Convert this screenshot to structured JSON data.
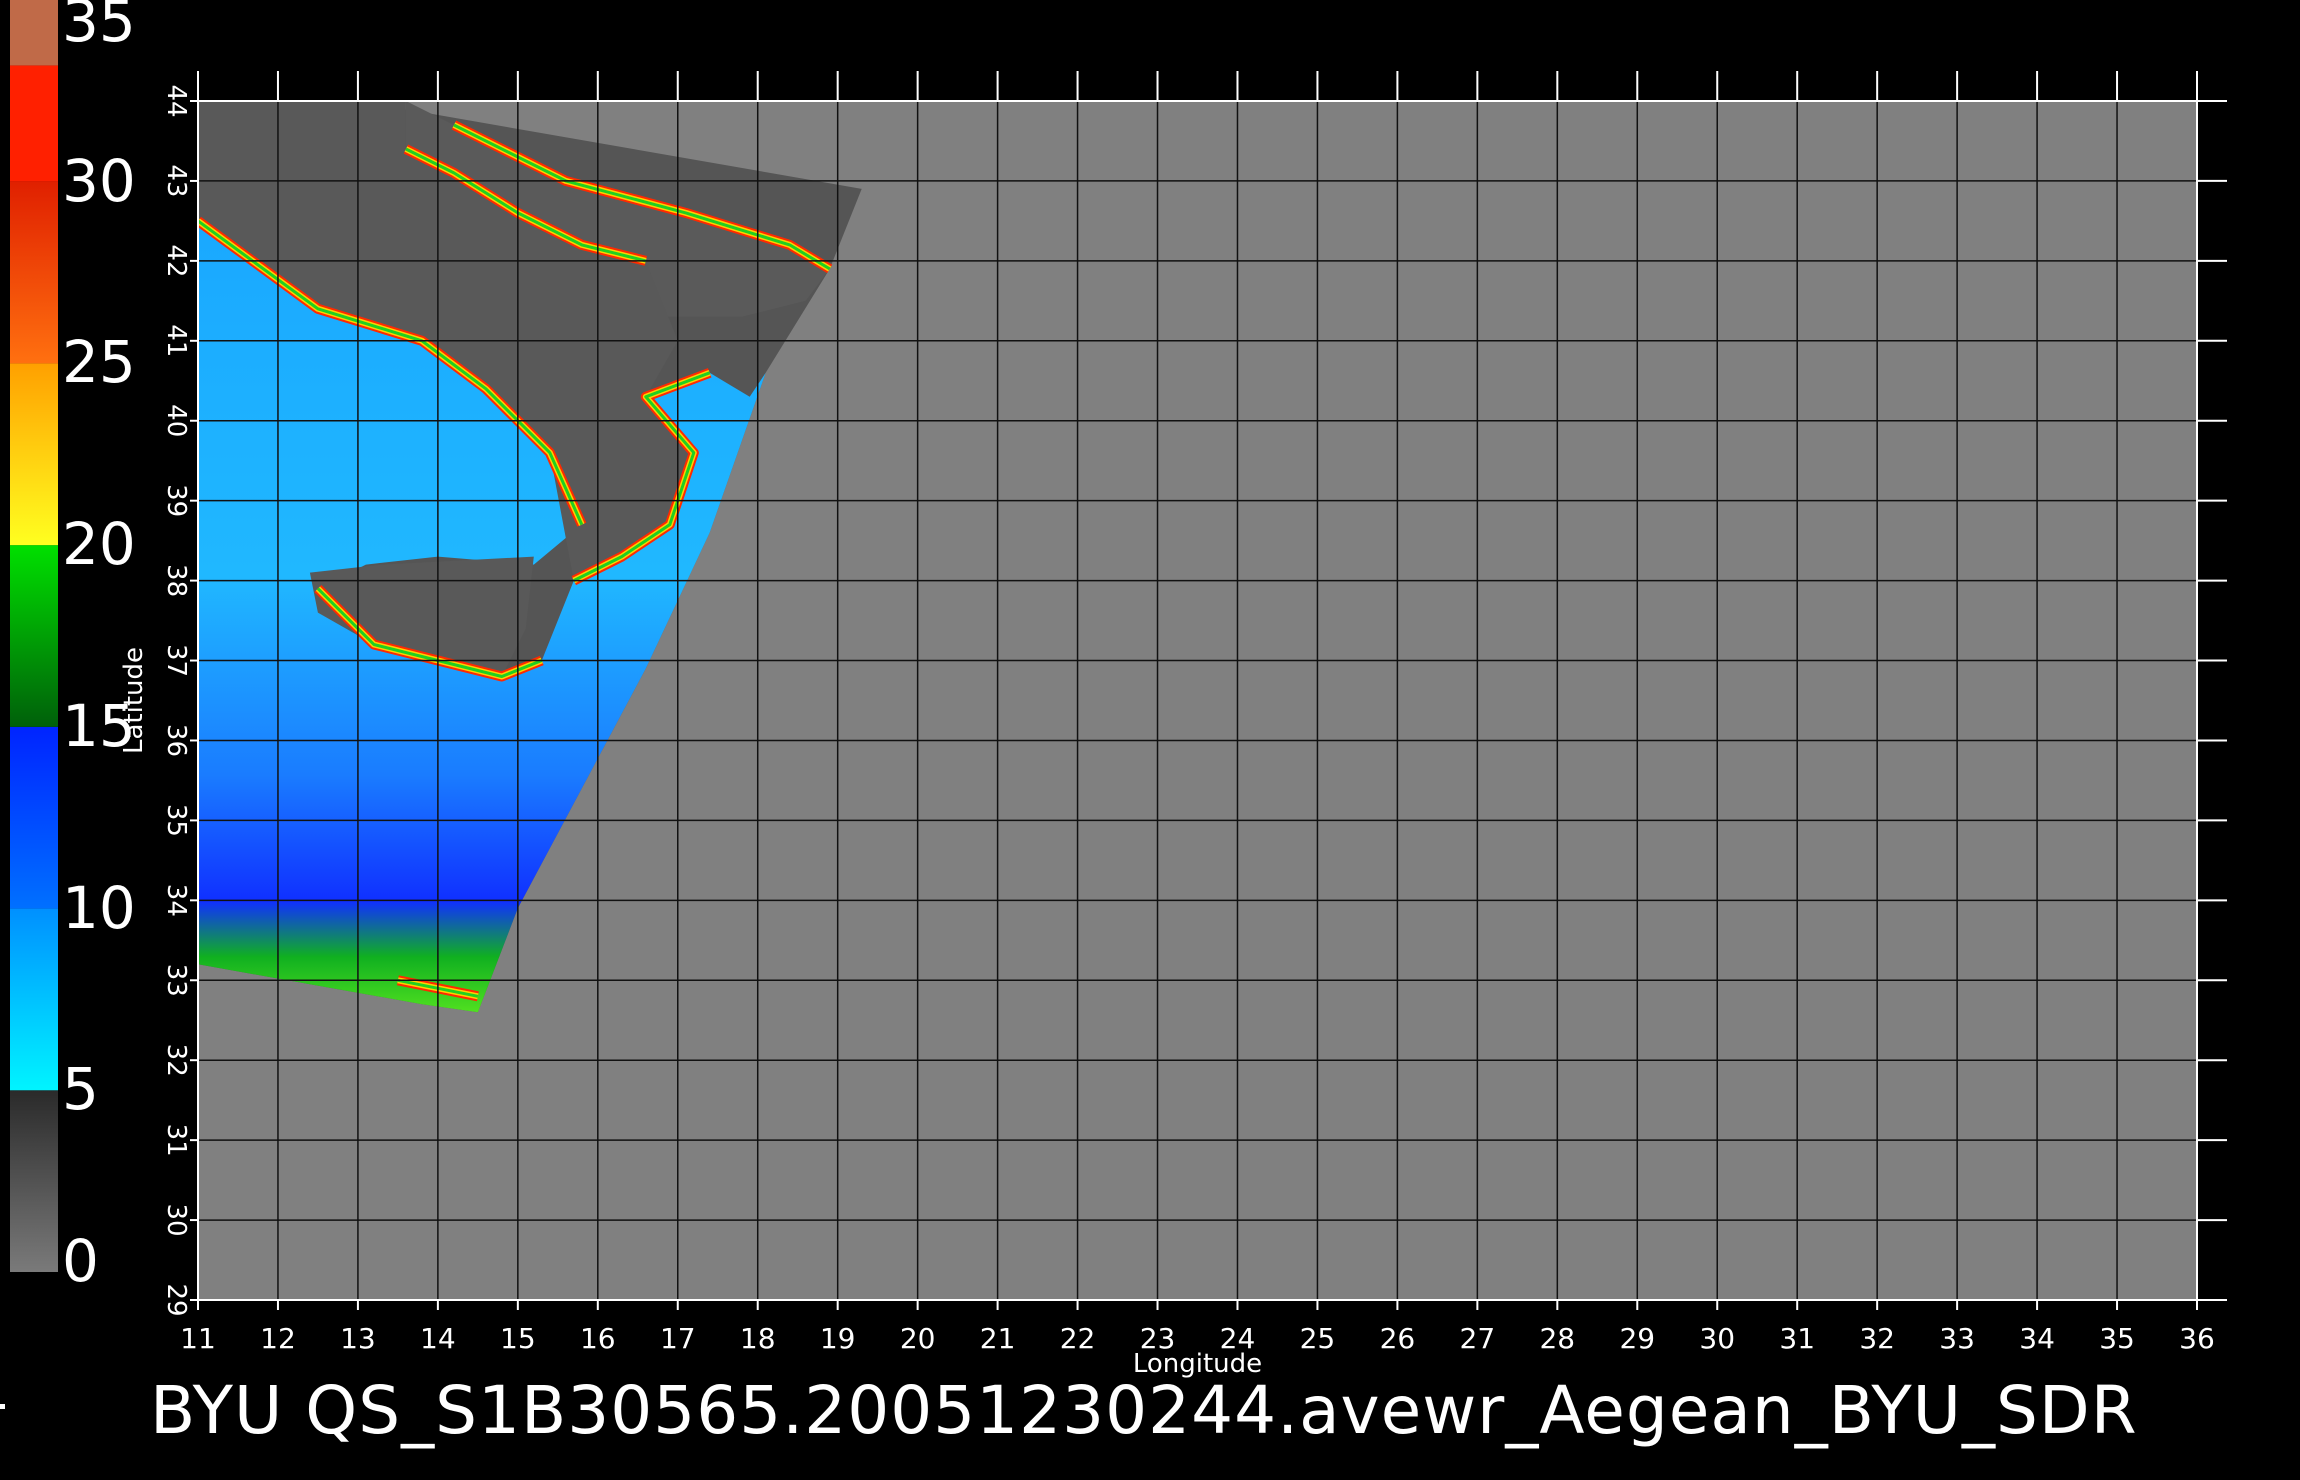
{
  "colorbar": {
    "labels": [
      "35",
      "30",
      "25",
      "20",
      "15",
      "10",
      "5",
      "0"
    ],
    "bands": [
      {
        "from": 0,
        "to": 5,
        "colors": [
          "#7a7a7a",
          "#2a2a2a"
        ]
      },
      {
        "from": 5,
        "to": 10,
        "colors": [
          "#00f4ff",
          "#0090ff"
        ]
      },
      {
        "from": 10,
        "to": 15,
        "colors": [
          "#0070ff",
          "#0024ff"
        ]
      },
      {
        "from": 15,
        "to": 20,
        "colors": [
          "#00600a",
          "#00e000"
        ]
      },
      {
        "from": 20,
        "to": 25,
        "colors": [
          "#ffff20",
          "#ffa000"
        ]
      },
      {
        "from": 25,
        "to": 30,
        "colors": [
          "#ff7010",
          "#e02000"
        ]
      },
      {
        "from": 30,
        "to": 33.2,
        "colors": [
          "#ff2000",
          "#ff2000"
        ]
      },
      {
        "from": 33.2,
        "to": 35,
        "colors": [
          "#c06a48",
          "#c06a48"
        ]
      }
    ]
  },
  "map": {
    "lon_range": [
      11,
      36
    ],
    "lat_range": [
      29,
      44
    ],
    "lon_ticks": [
      "11",
      "12",
      "13",
      "14",
      "15",
      "16",
      "17",
      "18",
      "19",
      "20",
      "21",
      "22",
      "23",
      "24",
      "25",
      "26",
      "27",
      "28",
      "29",
      "30",
      "31",
      "32",
      "33",
      "34",
      "35",
      "36"
    ],
    "lat_ticks": [
      "29",
      "30",
      "31",
      "32",
      "33",
      "34",
      "35",
      "36",
      "37",
      "38",
      "39",
      "40",
      "41",
      "42",
      "43",
      "44"
    ],
    "xlabel": "Longitude",
    "ylabel": "Latitude",
    "background_color": "#808080",
    "swath_gray": "#555555",
    "grid": true
  },
  "caption": "BYU QS_S1B30565.20051230244.avewr_Aegean_BYU_SDR"
}
